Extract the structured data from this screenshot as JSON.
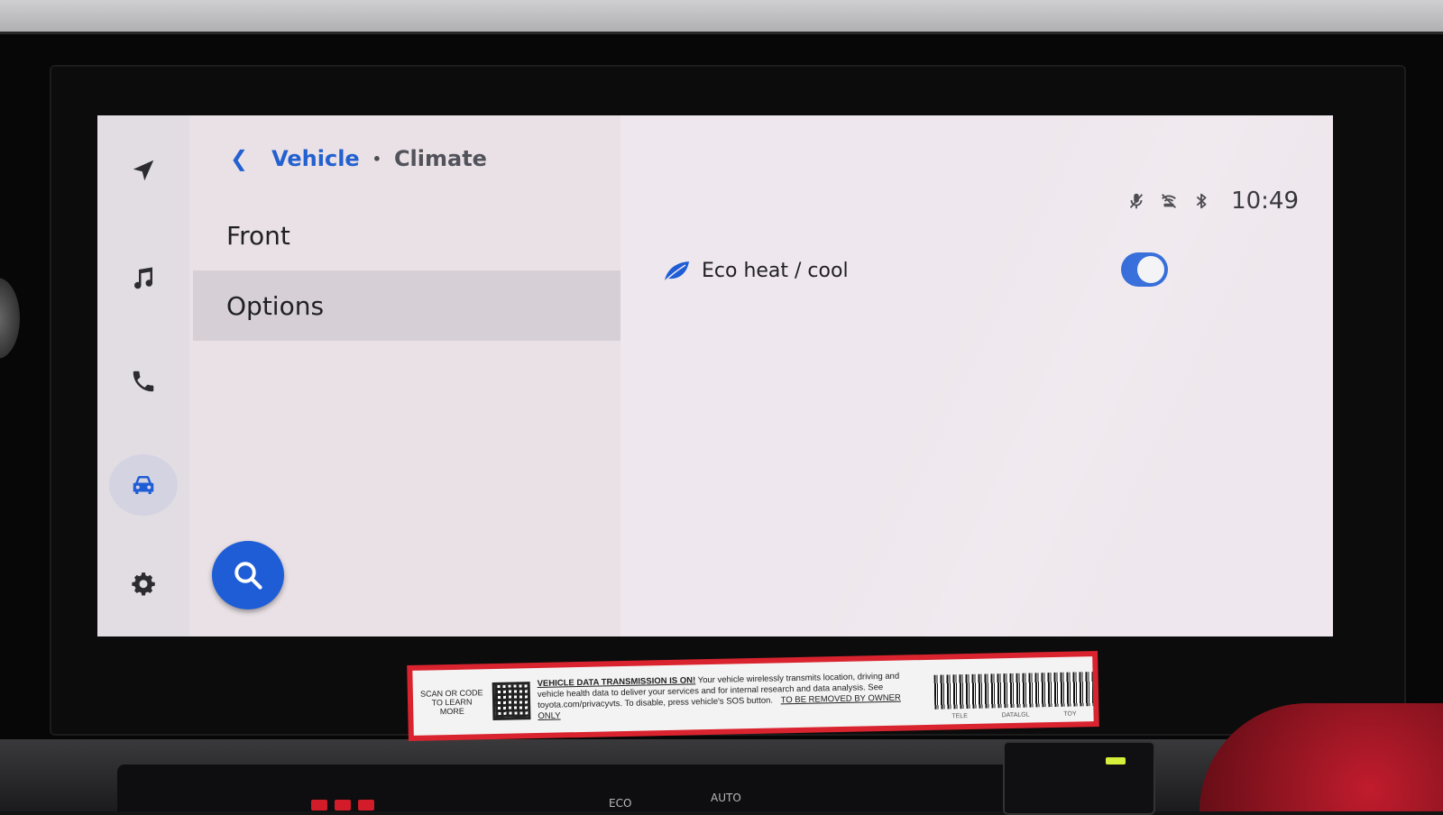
{
  "breadcrumb": {
    "parent": "Vehicle",
    "separator": "•",
    "current": "Climate"
  },
  "rail": {
    "items": [
      {
        "icon": "navigation-icon"
      },
      {
        "icon": "music-icon"
      },
      {
        "icon": "phone-icon"
      },
      {
        "icon": "car-icon",
        "active": true
      },
      {
        "icon": "gear-icon"
      }
    ]
  },
  "menu": {
    "items": [
      {
        "label": "Front",
        "selected": false
      },
      {
        "label": "Options",
        "selected": true
      }
    ]
  },
  "search": {
    "icon": "search-icon"
  },
  "status": {
    "icons": [
      "mic-off-icon",
      "wireless-charging-off-icon",
      "bluetooth-icon"
    ],
    "time": "10:49"
  },
  "settings": [
    {
      "icon": "leaf-icon",
      "label": "Eco heat / cool",
      "enabled": true
    }
  ],
  "colors": {
    "accent": "#1f5dd6",
    "background": "#ece5ea",
    "selected_row": "#d6d0d6"
  },
  "sticker": {
    "scan_text": "SCAN OR CODE TO LEARN MORE",
    "title": "VEHICLE DATA TRANSMISSION IS ON!",
    "body": "Your vehicle wirelessly transmits location, driving and vehicle health data to deliver your services and for internal research and data analysis. See toyota.com/privacyvts. To disable, press vehicle's SOS button.",
    "remove_notice": "TO BE REMOVED BY OWNER ONLY",
    "barcode_labels": [
      "TELE",
      "DATALGL",
      "TOY"
    ]
  },
  "console": {
    "eco_label": "ECO",
    "auto_label": "AUTO"
  }
}
